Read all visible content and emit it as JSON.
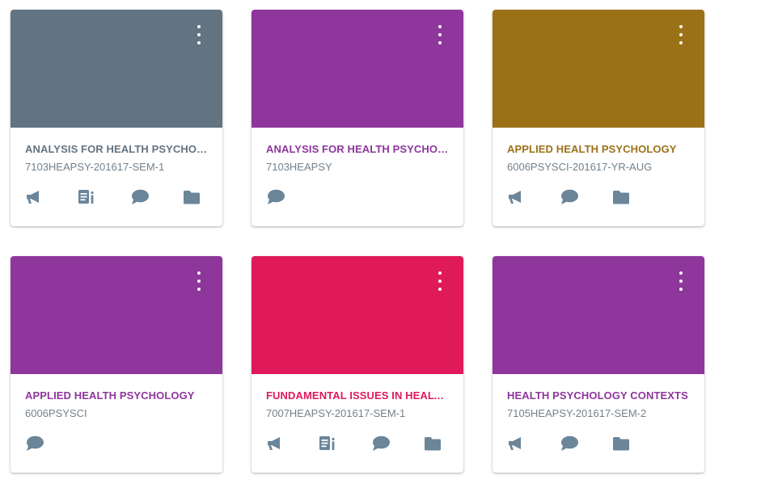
{
  "colors": {
    "icon": "#6b8599",
    "code_text": "#73818c"
  },
  "cards": [
    {
      "color": "#627381",
      "title": "ANALYSIS FOR HEALTH PSYCHOLOGY",
      "code": "7103HEAPSY-201617-SEM-1",
      "actions": [
        "megaphone-icon",
        "assignment-icon",
        "discussion-icon",
        "folder-icon"
      ]
    },
    {
      "color": "#8e369c",
      "title": "ANALYSIS FOR HEALTH PSYCHOLOGY",
      "code": "7103HEAPSY",
      "actions": [
        "discussion-icon"
      ]
    },
    {
      "color": "#9b7118",
      "title": "APPLIED HEALTH PSYCHOLOGY",
      "code": "6006PSYSCI-201617-YR-AUG",
      "actions": [
        "megaphone-icon",
        "discussion-icon",
        "folder-icon"
      ]
    },
    {
      "color": "#8e369c",
      "title": "APPLIED HEALTH PSYCHOLOGY",
      "code": "6006PSYSCI",
      "actions": [
        "discussion-icon"
      ]
    },
    {
      "color": "#e0195a",
      "title": "FUNDAMENTAL ISSUES IN HEALTH PSYCHOLOGY",
      "code": "7007HEAPSY-201617-SEM-1",
      "actions": [
        "megaphone-icon",
        "assignment-icon",
        "discussion-icon",
        "folder-icon"
      ]
    },
    {
      "color": "#8e369c",
      "title": "HEALTH PSYCHOLOGY CONTEXTS",
      "code": "7105HEAPSY-201617-SEM-2",
      "actions": [
        "megaphone-icon",
        "discussion-icon",
        "folder-icon"
      ]
    }
  ]
}
